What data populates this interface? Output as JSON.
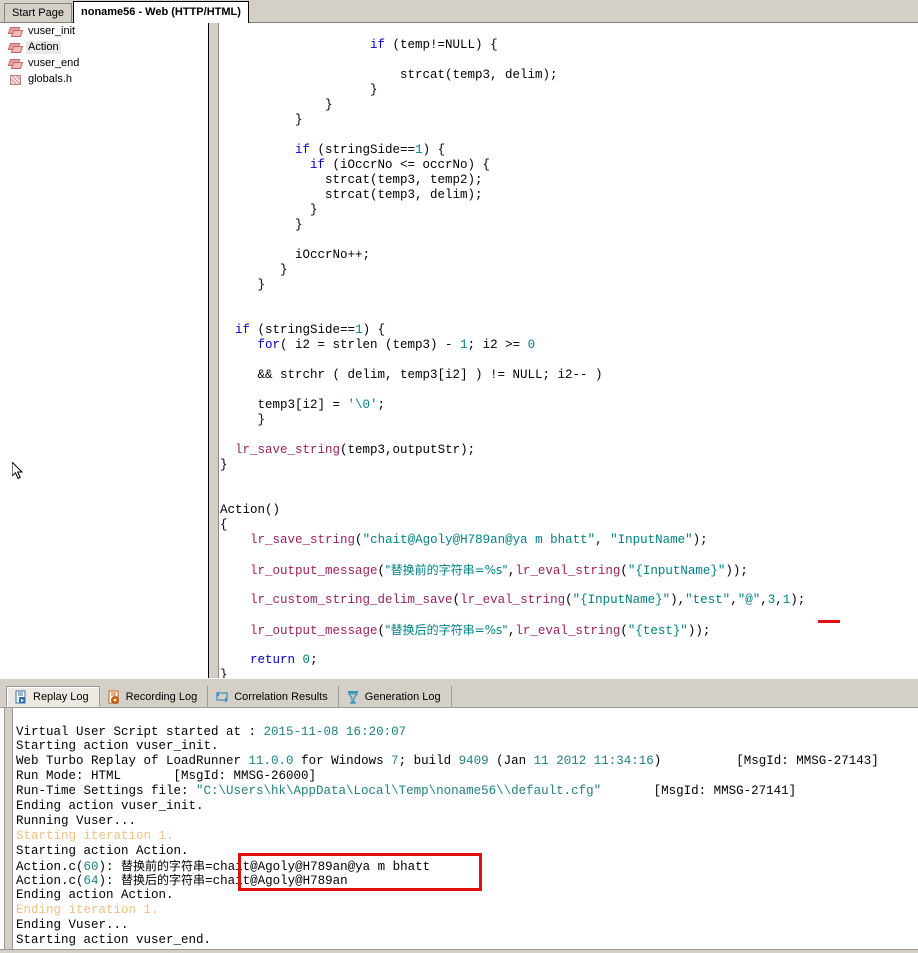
{
  "window": {
    "document_tabs": [
      {
        "label": "Start Page",
        "active": false
      },
      {
        "label": "noname56 - Web (HTTP/HTML)",
        "active": true
      }
    ]
  },
  "tree": {
    "items": [
      {
        "label": "vuser_init",
        "icon": "action-brick-icon",
        "selected": false
      },
      {
        "label": "Action",
        "icon": "action-brick-icon",
        "selected": true
      },
      {
        "label": "vuser_end",
        "icon": "action-brick-icon",
        "selected": false
      },
      {
        "label": "globals.h",
        "icon": "header-file-icon",
        "selected": false
      }
    ]
  },
  "editor": {
    "lines": [
      "                    if (temp!=NULL) {",
      "",
      "                        strcat(temp3, delim);",
      "                    }",
      "              }",
      "          }",
      "",
      "          if (stringSide==1) {",
      "            if (iOccrNo <= occrNo) {",
      "              strcat(temp3, temp2);",
      "              strcat(temp3, delim);",
      "            }",
      "          }",
      "",
      "          iOccrNo++;",
      "        }",
      "     }",
      "",
      "",
      "  if (stringSide==1) {",
      "     for( i2 = strlen (temp3) - 1; i2 >= 0",
      "",
      "     && strchr ( delim, temp3[i2] ) != NULL; i2-- )",
      "",
      "     temp3[i2] = '\\0';",
      "     }",
      "",
      "  lr_save_string(temp3,outputStr);",
      "}",
      "",
      "",
      "Action()",
      "{",
      "    lr_save_string(\"chait@Agoly@H789an@ya m bhatt\", \"InputName\");",
      "",
      "    lr_output_message(\"替换前的字符串=%s\",lr_eval_string(\"{InputName}\"));",
      "",
      "    lr_custom_string_delim_save(lr_eval_string(\"{InputName}\"),\"test\",\"@\",3,1);",
      "",
      "    lr_output_message(\"替换后的字符串=%s\",lr_eval_string(\"{test}\"));",
      "",
      "    return 0;",
      "}"
    ],
    "annotation": {
      "type": "red-underline",
      "target": "3,1"
    }
  },
  "log_panel": {
    "tabs": [
      {
        "label": "Replay Log",
        "icon": "replay-log-icon",
        "active": true
      },
      {
        "label": "Recording Log",
        "icon": "recording-log-icon",
        "active": false
      },
      {
        "label": "Correlation Results",
        "icon": "correlation-results-icon",
        "active": false
      },
      {
        "label": "Generation Log",
        "icon": "generation-log-icon",
        "active": false
      }
    ],
    "lines": [
      "Virtual User Script started at : 2015-11-08 16:20:07",
      "Starting action vuser_init.",
      "Web Turbo Replay of LoadRunner 11.0.0 for Windows 7; build 9409 (Jan 11 2012 11:34:16)          [MsgId: MMSG-27143]",
      "Run Mode: HTML       [MsgId: MMSG-26000]",
      "Run-Time Settings file: \"C:\\Users\\hk\\AppData\\Local\\Temp\\noname56\\\\default.cfg\"       [MsgId: MMSG-27141]",
      "Ending action vuser_init.",
      "Running Vuser...",
      "Starting iteration 1.",
      "Starting action Action.",
      "Action.c(60): 替换前的字符串=chait@Agoly@H789an@ya m bhatt",
      "Action.c(64): 替换后的字符串=chait@Agoly@H789an",
      "Ending action Action.",
      "Ending iteration 1.",
      "Ending Vuser...",
      "Starting action vuser_end."
    ],
    "annotation": {
      "type": "red-box",
      "target": "replaced string output values"
    }
  },
  "colors": {
    "keyword": "#0000cd",
    "number": "#008080",
    "string": "#008080",
    "lr_function": "#9b2060",
    "iteration_marker": "#f0c089",
    "annotation_red": "#e01010",
    "chrome": "#d4d0c8"
  }
}
